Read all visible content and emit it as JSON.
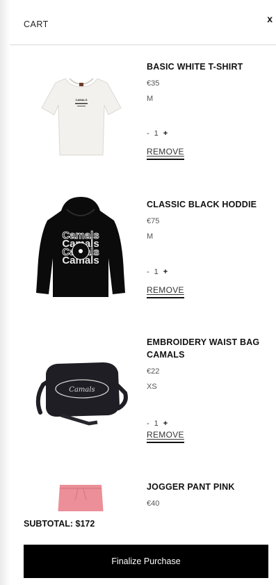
{
  "header": {
    "title": "CART",
    "close_label": "x"
  },
  "items": [
    {
      "name": "BASIC WHITE T-SHIRT",
      "price": "€35",
      "size": "M",
      "qty_minus": "-",
      "quantity": "1",
      "qty_plus": "+",
      "remove_label": "REMOVE",
      "image_icon": "white-tshirt-image",
      "print_text": "CAMALS"
    },
    {
      "name": "CLASSIC BLACK HODDIE",
      "price": "€75",
      "size": "M",
      "qty_minus": "-",
      "quantity": "1",
      "qty_plus": "+",
      "remove_label": "REMOVE",
      "image_icon": "black-hoodie-image",
      "print_text": "Camals"
    },
    {
      "name": "EMBROIDERY WAIST BAG CAMALS",
      "price": "€22",
      "size": "XS",
      "qty_minus": "-",
      "quantity": "1",
      "qty_plus": "+",
      "remove_label": "REMOVE",
      "image_icon": "waist-bag-image",
      "print_text": "Camals"
    },
    {
      "name": "JOGGER PANT PINK",
      "price": "€40",
      "image_icon": "pink-jogger-image"
    }
  ],
  "footer": {
    "subtotal": "SUBTOTAL: $172",
    "finalize_label": "Finalize Purchase"
  },
  "colors": {
    "button_bg": "#000000",
    "hoodie": "#0b0b0b",
    "bag": "#1e1e24",
    "jogger": "#ec8f98",
    "tshirt": "#f3f1ee"
  }
}
